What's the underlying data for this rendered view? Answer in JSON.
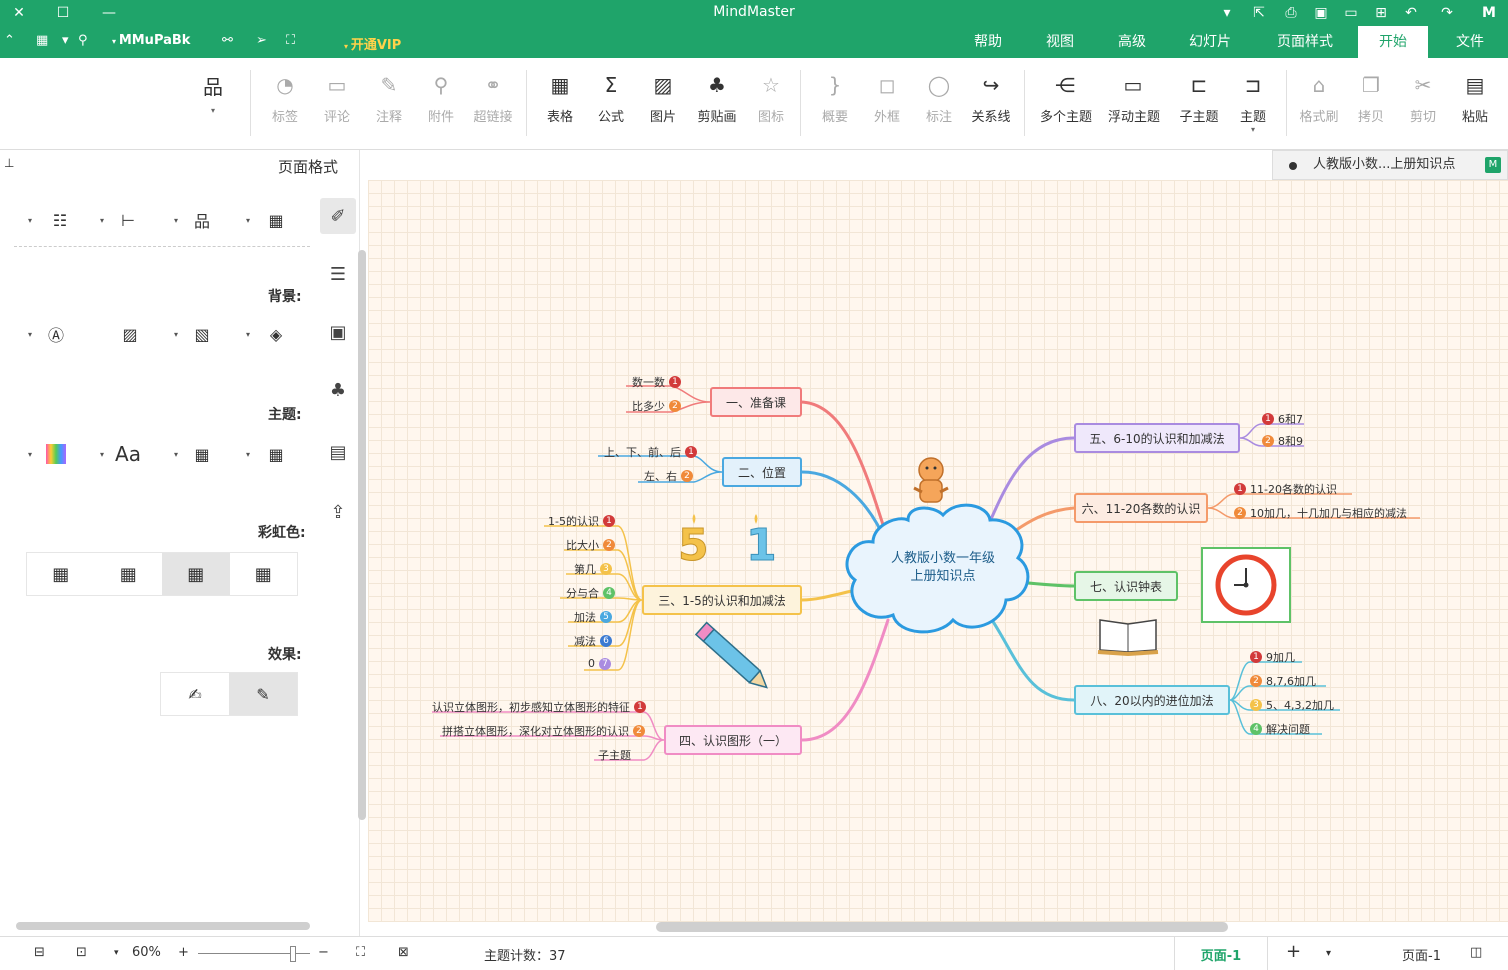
{
  "window": {
    "title": "MindMaster",
    "user": "MMuPaBk",
    "vip_label": "开通VIP"
  },
  "menu": {
    "tabs": [
      "文件",
      "开始",
      "页面样式",
      "幻灯片",
      "高级",
      "视图",
      "帮助"
    ],
    "active": "开始"
  },
  "ribbon": {
    "buttons": {
      "paste": "粘贴",
      "cut": "剪切",
      "copy": "拷贝",
      "format_painter": "格式刷",
      "topic": "主题",
      "subtopic": "子主题",
      "floating_topic": "浮动主题",
      "multi_topic": "多个主题",
      "relationship": "关系线",
      "callout": "标注",
      "boundary": "外框",
      "summary": "概要",
      "icon": "图标",
      "clipart": "剪贴画",
      "image": "图片",
      "formula": "公式",
      "table": "表格",
      "hyperlink": "超链接",
      "attachment": "附件",
      "note": "注释",
      "comment": "评论",
      "tag": "标签"
    }
  },
  "left_panel": {
    "title": "页面格式",
    "background_label": "背景:",
    "theme_label": "主题:",
    "rainbow_label": "彩虹色:",
    "effects_label": "效果:"
  },
  "document_tab": {
    "name": "人教版小数...上册知识点"
  },
  "mindmap": {
    "central": [
      "人教版小数一年级",
      "上册知识点"
    ],
    "colors": {
      "c1": "#f07b7b",
      "c2": "#4aa8e0",
      "c3": "#f4c24a",
      "c4": "#f08cc4",
      "c5": "#a98be0",
      "c6": "#f49a6a",
      "c7": "#5ec267",
      "c8": "#59c0d9",
      "central": "#2b9ae0"
    },
    "branches": {
      "b1": {
        "label": "一、准备课",
        "leaves": [
          "数一数",
          "比多少"
        ]
      },
      "b2": {
        "label": "二、位置",
        "leaves": [
          "上、下、前、后",
          "左、右"
        ]
      },
      "b3": {
        "label": "三、1-5的认识和加减法",
        "leaves": [
          "1-5的认识",
          "比大小",
          "第几",
          "分与合",
          "加法",
          "减法",
          "0"
        ]
      },
      "b4": {
        "label": "四、认识图形（一）",
        "leaves": [
          "认识立体图形，初步感知立体图形的特征",
          "拼搭立体图形，深化对立体图形的认识",
          "子主题"
        ]
      },
      "b5": {
        "label": "五、6-10的认识和加减法",
        "leaves": [
          "6和7",
          "8和9"
        ]
      },
      "b6": {
        "label": "六、11-20各数的认识",
        "leaves": [
          "11-20各数的认识",
          "10加几，十几加几与相应的减法"
        ]
      },
      "b7": {
        "label": "七、认识钟表",
        "leaves": []
      },
      "b8": {
        "label": "八、20以内的进位加法",
        "leaves": [
          "9加几",
          "8,7,6加几",
          "5、4,3,2加几",
          "解决问题"
        ]
      }
    }
  },
  "status": {
    "page_label": "页面-1",
    "page_tab": "页面-1",
    "topic_count": "主题计数：37",
    "zoom": "60%"
  }
}
